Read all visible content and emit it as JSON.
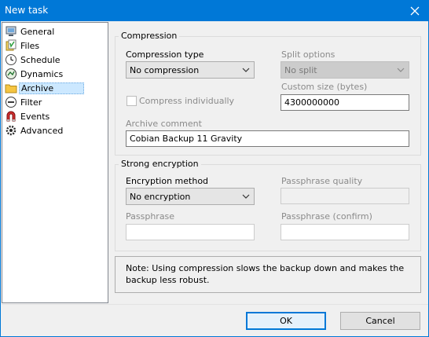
{
  "window": {
    "title": "New task"
  },
  "sidebar": {
    "items": [
      {
        "label": "General",
        "icon": "computer-icon"
      },
      {
        "label": "Files",
        "icon": "files-icon"
      },
      {
        "label": "Schedule",
        "icon": "clock-icon"
      },
      {
        "label": "Dynamics",
        "icon": "dynamics-icon"
      },
      {
        "label": "Archive",
        "icon": "folder-icon",
        "selected": true
      },
      {
        "label": "Filter",
        "icon": "filter-icon"
      },
      {
        "label": "Events",
        "icon": "magnet-icon"
      },
      {
        "label": "Advanced",
        "icon": "gear-icon"
      }
    ]
  },
  "compression": {
    "group_title": "Compression",
    "type_label": "Compression type",
    "type_value": "No compression",
    "split_label": "Split options",
    "split_value": "No split",
    "custom_size_label": "Custom size (bytes)",
    "custom_size_value": "4300000000",
    "compress_individually_label": "Compress individually",
    "archive_comment_label": "Archive comment",
    "archive_comment_value": "Cobian Backup 11 Gravity"
  },
  "encryption": {
    "group_title": "Strong encryption",
    "method_label": "Encryption method",
    "method_value": "No encryption",
    "quality_label": "Passphrase quality",
    "passphrase_label": "Passphrase",
    "passphrase_value": "",
    "passphrase_confirm_label": "Passphrase (confirm)",
    "passphrase_confirm_value": ""
  },
  "note": {
    "text": "Note: Using compression slows the backup down and makes the backup less robust."
  },
  "buttons": {
    "ok": "OK",
    "cancel": "Cancel"
  },
  "colors": {
    "titlebar": "#0078d7",
    "selection": "#cce8ff",
    "default_button_border": "#0078d7"
  }
}
